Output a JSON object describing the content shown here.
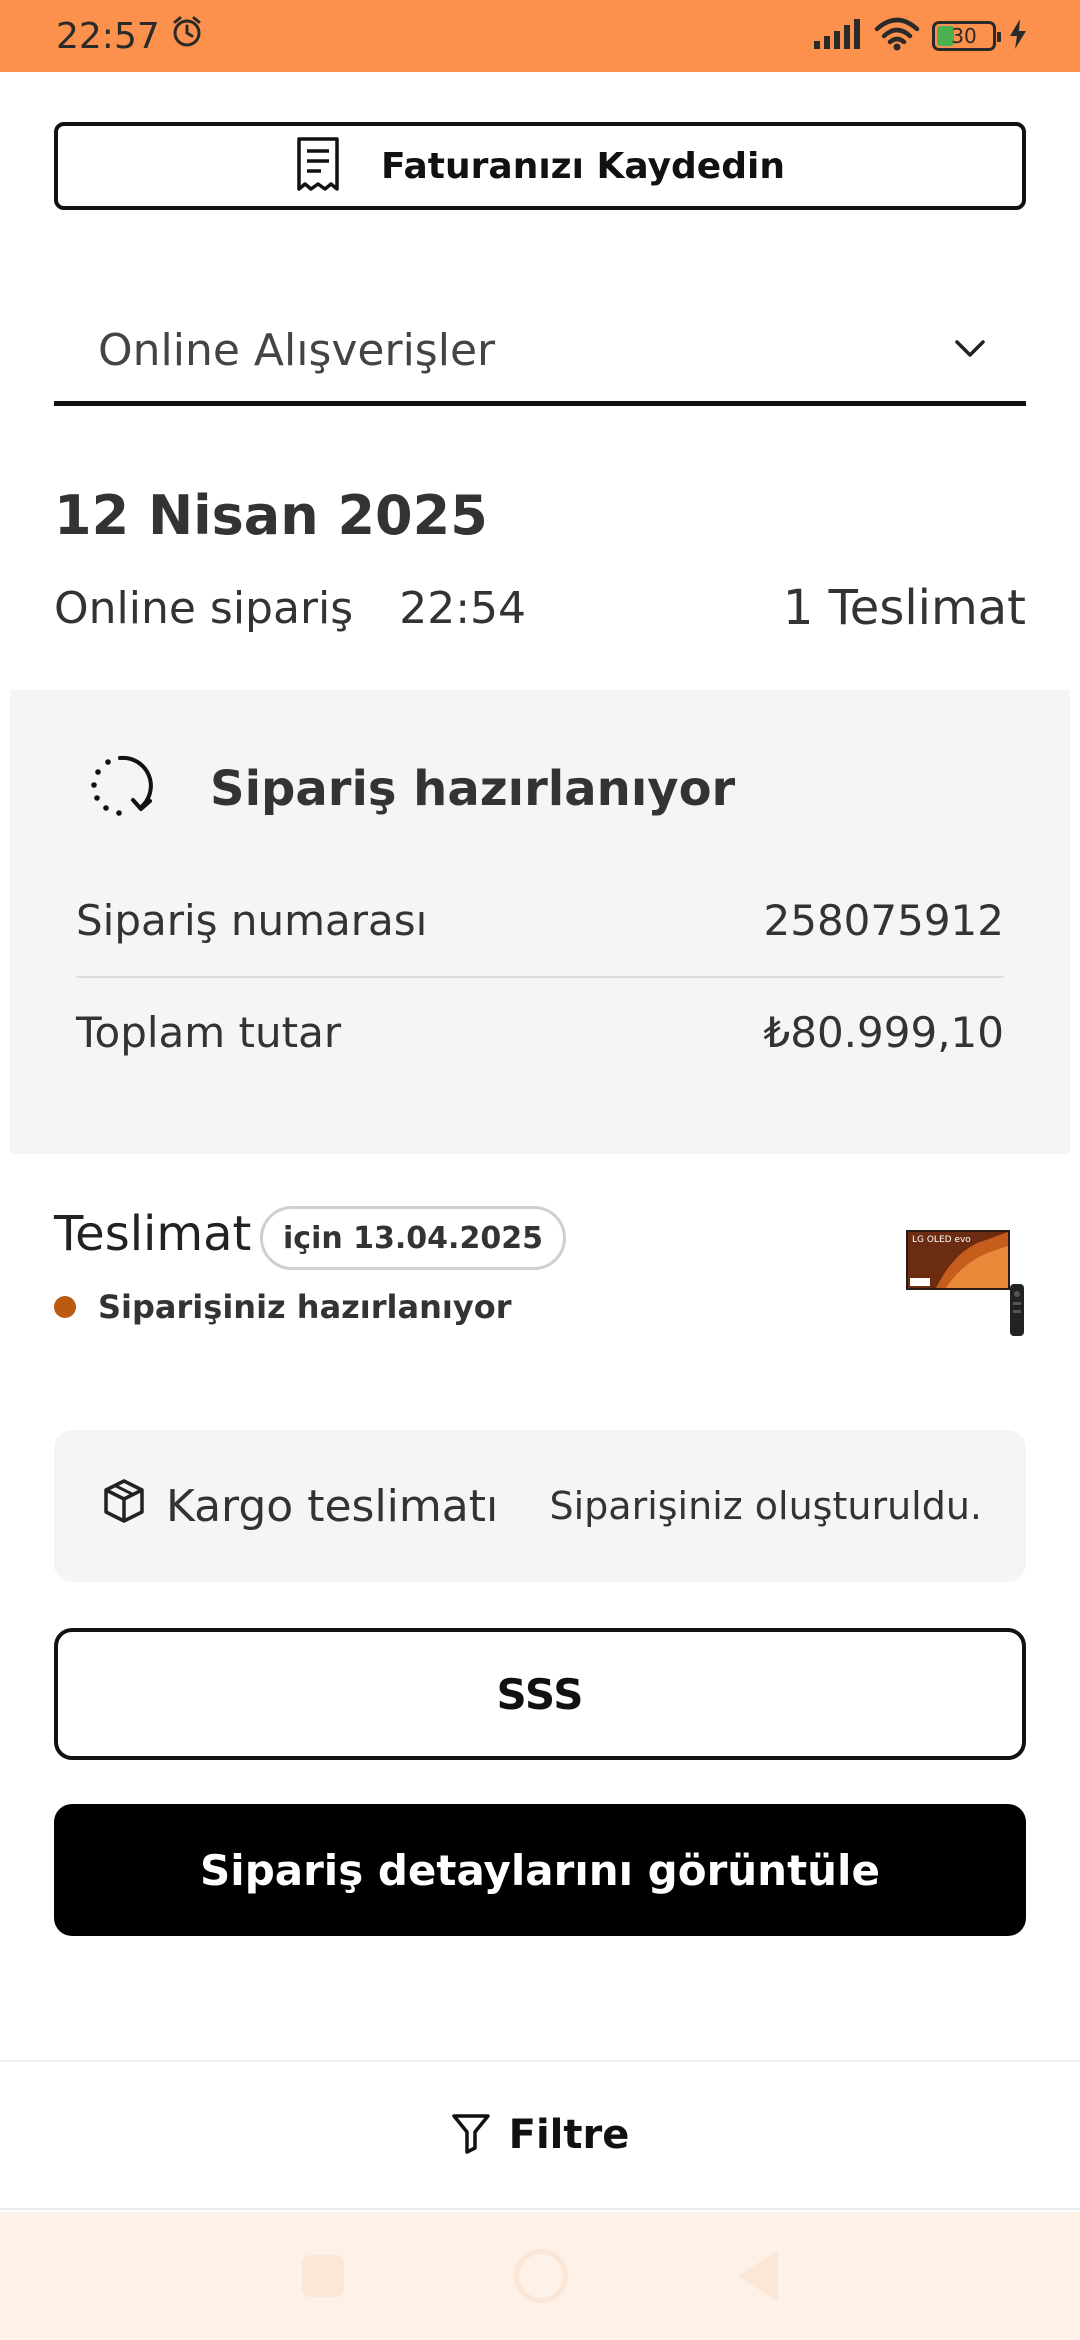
{
  "status_bar": {
    "time": "22:57",
    "battery": "30"
  },
  "invoice_button": {
    "label": "Faturanızı Kaydedin"
  },
  "dropdown": {
    "selected": "Online Alışverişler"
  },
  "order": {
    "date": "12 Nisan 2025",
    "type": "Online sipariş",
    "time": "22:54",
    "deliveries": "1 Teslimat"
  },
  "status_card": {
    "title": "Sipariş hazırlanıyor",
    "order_number_label": "Sipariş numarası",
    "order_number": "258075912",
    "total_label": "Toplam tutar",
    "total": "₺80.999,10"
  },
  "delivery": {
    "title": "Teslimat",
    "date_pill": "için 13.04.2025",
    "status": "Siparişiniz hazırlanıyor",
    "status_color": "#bb5a10",
    "thumb_text": "LG OLED evo"
  },
  "shipping": {
    "method": "Kargo teslimatı",
    "note": "Siparişiniz oluşturuldu."
  },
  "buttons": {
    "faq": "SSS",
    "details": "Sipariş detaylarını görüntüle"
  },
  "filter": {
    "label": "Filtre"
  },
  "colors": {
    "accent": "#fb914c",
    "card_bg": "#f5f5f5",
    "primary_button": "#000000"
  }
}
